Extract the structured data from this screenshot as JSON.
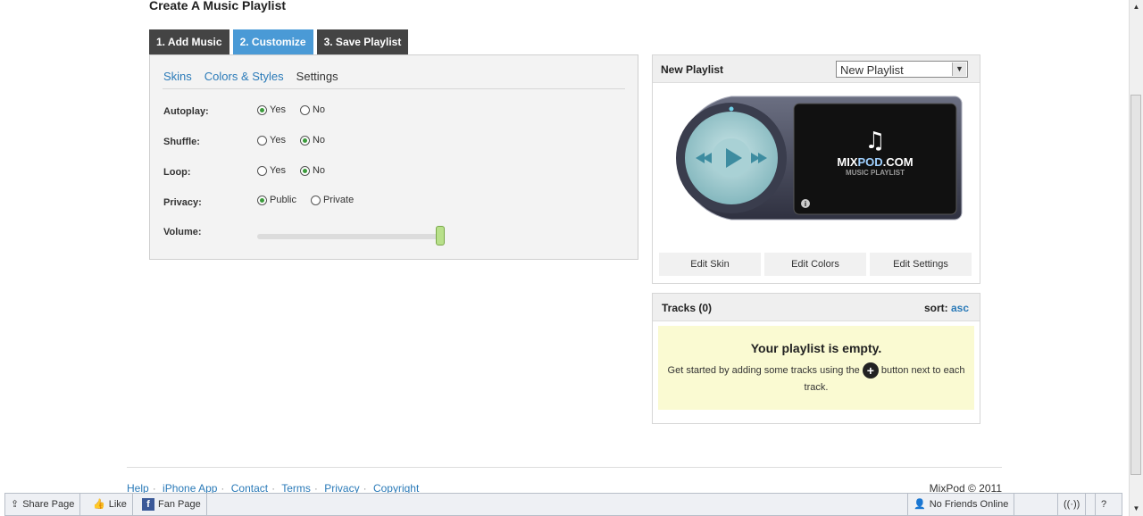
{
  "page": {
    "title": "Create A Music Playlist"
  },
  "steps": [
    {
      "label": "1. Add Music"
    },
    {
      "label": "2. Customize"
    },
    {
      "label": "3. Save Playlist"
    }
  ],
  "subtabs": [
    {
      "label": "Skins"
    },
    {
      "label": "Colors & Styles"
    },
    {
      "label": "Settings"
    }
  ],
  "settings": {
    "autoplay": {
      "label": "Autoplay:",
      "yes": "Yes",
      "no": "No",
      "selected": "Yes"
    },
    "shuffle": {
      "label": "Shuffle:",
      "yes": "Yes",
      "no": "No",
      "selected": "No"
    },
    "loop": {
      "label": "Loop:",
      "yes": "Yes",
      "no": "No",
      "selected": "No"
    },
    "privacy": {
      "label": "Privacy:",
      "public": "Public",
      "private": "Private",
      "selected": "Public"
    },
    "volume": {
      "label": "Volume:",
      "level": 1.0
    }
  },
  "playlist": {
    "title": "New Playlist",
    "select_value": "New Playlist",
    "player_brand": "MIXPOD.COM",
    "player_brand_blue": "POD",
    "player_sub": "MUSIC PLAYLIST",
    "edit_skin": "Edit Skin",
    "edit_colors": "Edit Colors",
    "edit_settings": "Edit Settings"
  },
  "tracks": {
    "title": "Tracks (0)",
    "sort_label": "sort:",
    "sort_value": "asc",
    "empty_heading": "Your playlist is empty.",
    "empty_text_before": "Get started by adding some tracks using the",
    "empty_text_after": "button next to each track."
  },
  "footer": {
    "links": [
      "Help",
      "iPhone App",
      "Contact",
      "Terms",
      "Privacy",
      "Copyright"
    ],
    "copyright": "MixPod © 2011"
  },
  "bottombar": {
    "share": "Share Page",
    "like": "Like",
    "fan": "Fan Page",
    "friends": "No Friends Online"
  },
  "colors": {
    "accent": "#4a9ad6",
    "link": "#2a7ab8",
    "step_bg": "#444444",
    "empty_bg": "#fafad2"
  }
}
